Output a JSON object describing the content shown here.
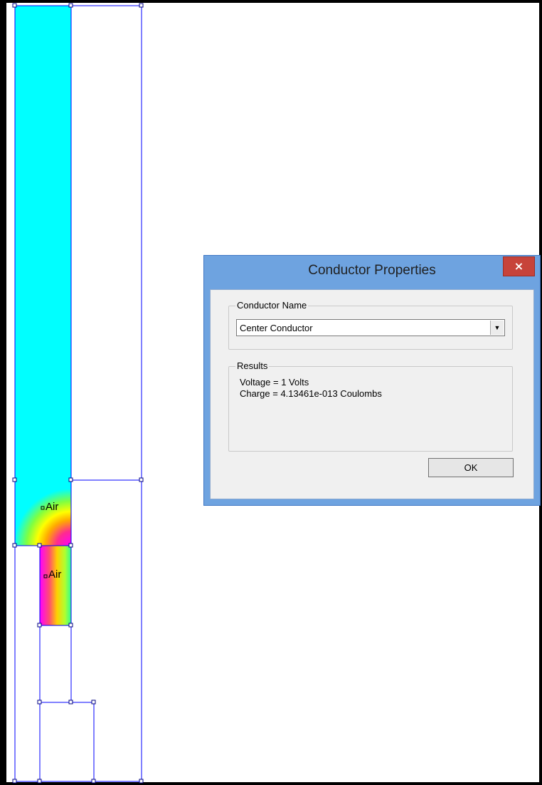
{
  "canvas": {
    "region_labels": [
      "Air",
      "Air"
    ]
  },
  "dialog": {
    "title": "Conductor Properties",
    "close_glyph": "×",
    "conductor_group_label": "Conductor Name",
    "conductor_name": "Center Conductor",
    "dropdown_glyph": "▼",
    "results_group_label": "Results",
    "voltage_text": "Voltage = 1 Volts",
    "charge_text": "Charge = 4.13461e-013 Coulombs",
    "ok_label": "OK"
  },
  "colors": {
    "field_cyan": "#00ffff",
    "geometry_line": "#0000ff",
    "title_bar": "#6ea3e0",
    "close_button": "#c7433a"
  }
}
